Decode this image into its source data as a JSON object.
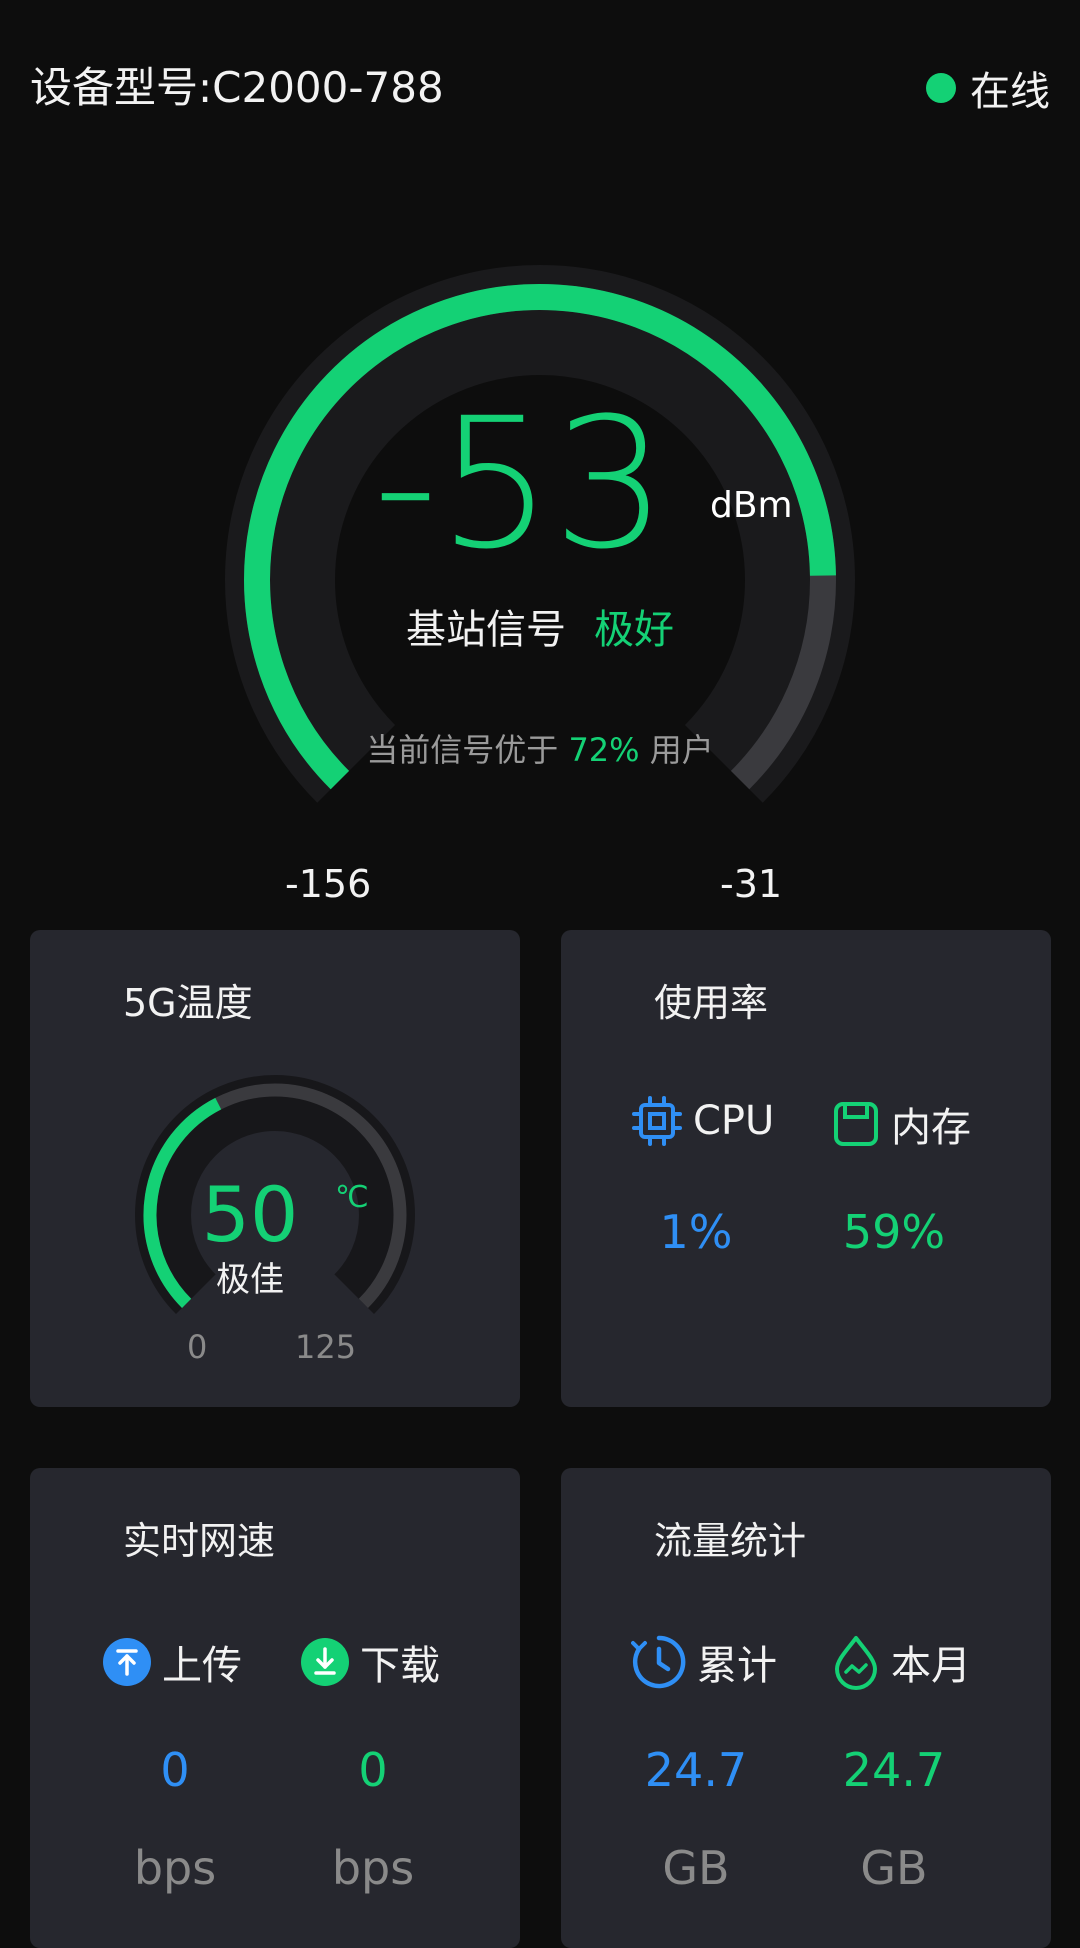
{
  "header": {
    "device_model": "设备型号:C2000-788",
    "status": "在线",
    "status_color": "#14d175"
  },
  "signal": {
    "value": "-53",
    "unit": "dBm",
    "label": "基站信号",
    "quality": "极好",
    "note_prefix": "当前信号优于",
    "note_percent": "72%",
    "note_suffix": "用户",
    "min": "-156",
    "max": "-31",
    "level_fraction": 0.83
  },
  "temperature": {
    "title": "5G温度",
    "value": "50",
    "unit": "℃",
    "quality": "极佳",
    "min": "0",
    "max": "125",
    "level_fraction": 0.4
  },
  "usage": {
    "title": "使用率",
    "cpu_label": "CPU",
    "cpu_icon": "cpu-chip-icon",
    "cpu_value": "1%",
    "memory_label": "内存",
    "memory_icon": "memory-icon",
    "memory_value": "59%"
  },
  "speed": {
    "title": "实时网速",
    "upload_label": "上传",
    "upload_icon": "upload-icon",
    "upload_value": "0",
    "upload_unit": "bps",
    "download_label": "下载",
    "download_icon": "download-icon",
    "download_value": "0",
    "download_unit": "bps"
  },
  "traffic": {
    "title": "流量统计",
    "total_label": "累计",
    "total_icon": "clock-icon",
    "total_value": "24.7",
    "total_unit": "GB",
    "month_label": "本月",
    "month_icon": "drop-icon",
    "month_value": "24.7",
    "month_unit": "GB"
  },
  "colors": {
    "accent_green": "#14d175",
    "accent_blue": "#2f8ff5",
    "card_bg": "#26272e",
    "page_bg": "#0d0d0d"
  }
}
